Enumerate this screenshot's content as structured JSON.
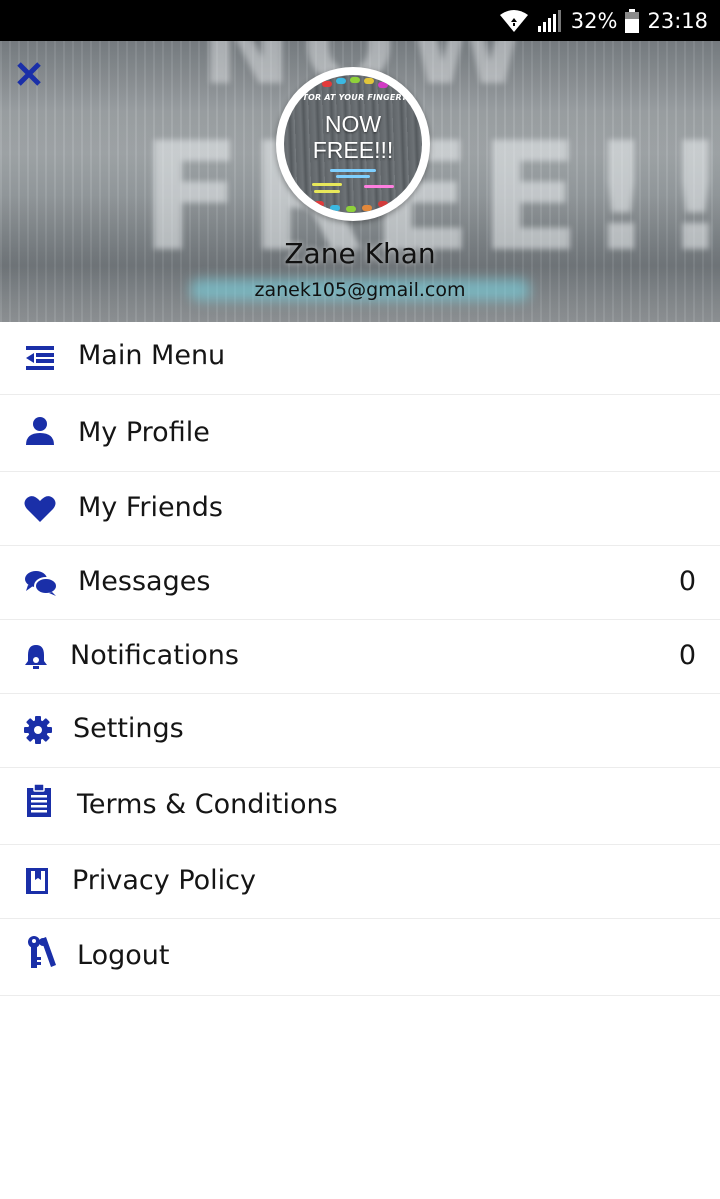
{
  "status_bar": {
    "battery": "32%",
    "time": "23:18"
  },
  "colors": {
    "accent": "#1a2fa8",
    "status_bar_bg": "#000000"
  },
  "header": {
    "close_icon": "close-icon",
    "avatar": {
      "banner_text": "UTOR AT YOUR FINGERTI",
      "line1": "NOW",
      "line2": "FREE!!!"
    },
    "background_text_top": "NOW",
    "background_text": "FREE!!!",
    "user_name": "Zane Khan",
    "user_email": "zanek105@gmail.com"
  },
  "menu": {
    "items": [
      {
        "label": "Main Menu",
        "icon": "indent-list-icon"
      },
      {
        "label": "My Profile",
        "icon": "user-icon"
      },
      {
        "label": "My Friends",
        "icon": "heart-icon"
      },
      {
        "label": "Messages",
        "icon": "chat-bubbles-icon",
        "count": "0"
      },
      {
        "label": "Notifications",
        "icon": "bell-icon",
        "count": "0"
      },
      {
        "label": "Settings",
        "icon": "gear-icon"
      },
      {
        "label": "Terms & Conditions",
        "icon": "clipboard-icon"
      },
      {
        "label": "Privacy Policy",
        "icon": "book-icon"
      },
      {
        "label": "Logout",
        "icon": "keys-icon"
      }
    ]
  }
}
